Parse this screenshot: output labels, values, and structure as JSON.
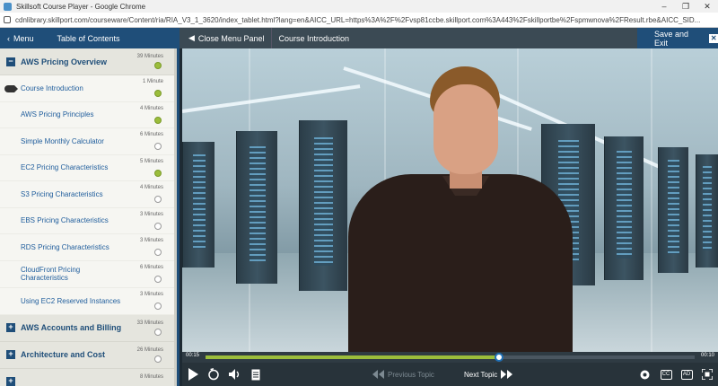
{
  "window": {
    "title": "Skillsoft Course Player - Google Chrome",
    "url": "cdnlibrary.skillport.com/courseware/Content/ria/RIA_V3_1_3620/index_tablet.html?lang=en&AICC_URL=https%3A%2F%2Fvsp81ccbe.skillport.com%3A443%2Fskillportbe%2Fspmwnova%2FResult.rbe&AICC_SID..."
  },
  "header": {
    "menu_label": "Menu",
    "toc_label": "Table of Contents",
    "close_panel_label": "Close Menu Panel",
    "current_topic": "Course Introduction",
    "save_exit_label": "Save and Exit"
  },
  "sidebar": {
    "sections": [
      {
        "title": "AWS Pricing Overview",
        "duration": "39 Minutes",
        "expanded": true,
        "items": [
          {
            "label": "Course Introduction",
            "duration": "1 Minute",
            "complete": true,
            "current": true
          },
          {
            "label": "AWS Pricing Principles",
            "duration": "4 Minutes",
            "complete": true
          },
          {
            "label": "Simple Monthly Calculator",
            "duration": "6 Minutes",
            "complete": false
          },
          {
            "label": "EC2 Pricing Characteristics",
            "duration": "5 Minutes",
            "complete": true
          },
          {
            "label": "S3 Pricing Characteristics",
            "duration": "4 Minutes",
            "complete": false
          },
          {
            "label": "EBS Pricing Characteristics",
            "duration": "3 Minutes",
            "complete": false
          },
          {
            "label": "RDS Pricing Characteristics",
            "duration": "3 Minutes",
            "complete": false
          },
          {
            "label": "CloudFront Pricing Characteristics",
            "duration": "6 Minutes",
            "complete": false
          },
          {
            "label": "Using EC2 Reserved Instances",
            "duration": "3 Minutes",
            "complete": false
          }
        ]
      },
      {
        "title": "AWS Accounts and Billing",
        "duration": "33 Minutes",
        "expanded": false
      },
      {
        "title": "Architecture and Cost",
        "duration": "26 Minutes",
        "expanded": false
      },
      {
        "title": "",
        "duration": "8 Minutes",
        "expanded": false
      }
    ]
  },
  "player": {
    "elapsed": "00:15",
    "total": "00:10",
    "progress": 0.6,
    "prev_label": "Previous Topic",
    "next_label": "Next Topic",
    "cc_label": "CC",
    "ad_label": "AD"
  },
  "colors": {
    "brand": "#1f4e79",
    "complete": "#9bbd3b",
    "link": "#1f5d9c"
  }
}
